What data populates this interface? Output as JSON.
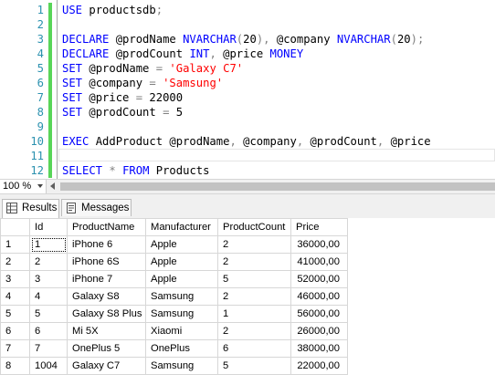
{
  "editor": {
    "lines": [
      {
        "num": "1",
        "tokens": [
          {
            "t": "USE",
            "c": "kw"
          },
          {
            "t": " productsdb",
            "c": "txt"
          },
          {
            "t": ";",
            "c": "op"
          }
        ]
      },
      {
        "num": "2",
        "tokens": []
      },
      {
        "num": "3",
        "tokens": [
          {
            "t": "DECLARE",
            "c": "kw"
          },
          {
            "t": " @prodName ",
            "c": "txt"
          },
          {
            "t": "NVARCHAR",
            "c": "kw"
          },
          {
            "t": "(",
            "c": "op"
          },
          {
            "t": "20",
            "c": "txt"
          },
          {
            "t": "),",
            "c": "op"
          },
          {
            "t": " @company ",
            "c": "txt"
          },
          {
            "t": "NVARCHAR",
            "c": "kw"
          },
          {
            "t": "(",
            "c": "op"
          },
          {
            "t": "20",
            "c": "txt"
          },
          {
            "t": ");",
            "c": "op"
          }
        ]
      },
      {
        "num": "4",
        "tokens": [
          {
            "t": "DECLARE",
            "c": "kw"
          },
          {
            "t": " @prodCount ",
            "c": "txt"
          },
          {
            "t": "INT",
            "c": "kw"
          },
          {
            "t": ",",
            "c": "op"
          },
          {
            "t": " @price ",
            "c": "txt"
          },
          {
            "t": "MONEY",
            "c": "kw"
          }
        ]
      },
      {
        "num": "5",
        "tokens": [
          {
            "t": "SET",
            "c": "kw"
          },
          {
            "t": " @prodName ",
            "c": "txt"
          },
          {
            "t": "=",
            "c": "op"
          },
          {
            "t": " ",
            "c": "txt"
          },
          {
            "t": "'Galaxy C7'",
            "c": "str"
          }
        ]
      },
      {
        "num": "6",
        "tokens": [
          {
            "t": "SET",
            "c": "kw"
          },
          {
            "t": " @company ",
            "c": "txt"
          },
          {
            "t": "=",
            "c": "op"
          },
          {
            "t": " ",
            "c": "txt"
          },
          {
            "t": "'Samsung'",
            "c": "str"
          }
        ]
      },
      {
        "num": "7",
        "tokens": [
          {
            "t": "SET",
            "c": "kw"
          },
          {
            "t": " @price ",
            "c": "txt"
          },
          {
            "t": "=",
            "c": "op"
          },
          {
            "t": " 22000",
            "c": "txt"
          }
        ]
      },
      {
        "num": "8",
        "tokens": [
          {
            "t": "SET",
            "c": "kw"
          },
          {
            "t": " @prodCount ",
            "c": "txt"
          },
          {
            "t": "=",
            "c": "op"
          },
          {
            "t": " 5",
            "c": "txt"
          }
        ]
      },
      {
        "num": "9",
        "tokens": []
      },
      {
        "num": "10",
        "tokens": [
          {
            "t": "EXEC",
            "c": "kw"
          },
          {
            "t": " AddProduct @prodName",
            "c": "txt"
          },
          {
            "t": ",",
            "c": "op"
          },
          {
            "t": " @company",
            "c": "txt"
          },
          {
            "t": ",",
            "c": "op"
          },
          {
            "t": " @prodCount",
            "c": "txt"
          },
          {
            "t": ",",
            "c": "op"
          },
          {
            "t": " @price",
            "c": "txt"
          }
        ]
      },
      {
        "num": "11",
        "tokens": []
      },
      {
        "num": "12",
        "tokens": [
          {
            "t": "SELECT",
            "c": "kw"
          },
          {
            "t": " ",
            "c": "txt"
          },
          {
            "t": "*",
            "c": "op"
          },
          {
            "t": " ",
            "c": "txt"
          },
          {
            "t": "FROM",
            "c": "kw"
          },
          {
            "t": " Products",
            "c": "txt"
          }
        ]
      }
    ]
  },
  "zoom": {
    "value": "100 %"
  },
  "tabs": [
    {
      "label": "Results",
      "active": true
    },
    {
      "label": "Messages",
      "active": false
    }
  ],
  "grid": {
    "columns": [
      "Id",
      "ProductName",
      "Manufacturer",
      "ProductCount",
      "Price"
    ],
    "rows": [
      {
        "rownum": "1",
        "cells": [
          "1",
          "iPhone 6",
          "Apple",
          "2",
          "36000,00"
        ]
      },
      {
        "rownum": "2",
        "cells": [
          "2",
          "iPhone 6S",
          "Apple",
          "2",
          "41000,00"
        ]
      },
      {
        "rownum": "3",
        "cells": [
          "3",
          "iPhone 7",
          "Apple",
          "5",
          "52000,00"
        ]
      },
      {
        "rownum": "4",
        "cells": [
          "4",
          "Galaxy S8",
          "Samsung",
          "2",
          "46000,00"
        ]
      },
      {
        "rownum": "5",
        "cells": [
          "5",
          "Galaxy S8 Plus",
          "Samsung",
          "1",
          "56000,00"
        ]
      },
      {
        "rownum": "6",
        "cells": [
          "6",
          "Mi 5X",
          "Xiaomi",
          "2",
          "26000,00"
        ]
      },
      {
        "rownum": "7",
        "cells": [
          "7",
          "OnePlus 5",
          "OnePlus",
          "6",
          "38000,00"
        ]
      },
      {
        "rownum": "8",
        "cells": [
          "1004",
          "Galaxy C7",
          "Samsung",
          "5",
          "22000,00"
        ]
      }
    ]
  },
  "colors": {
    "keyword": "#0000ff",
    "string": "#ff0000",
    "operator": "#808080",
    "line_number": "#2b91af",
    "change_marker": "#58d558"
  }
}
